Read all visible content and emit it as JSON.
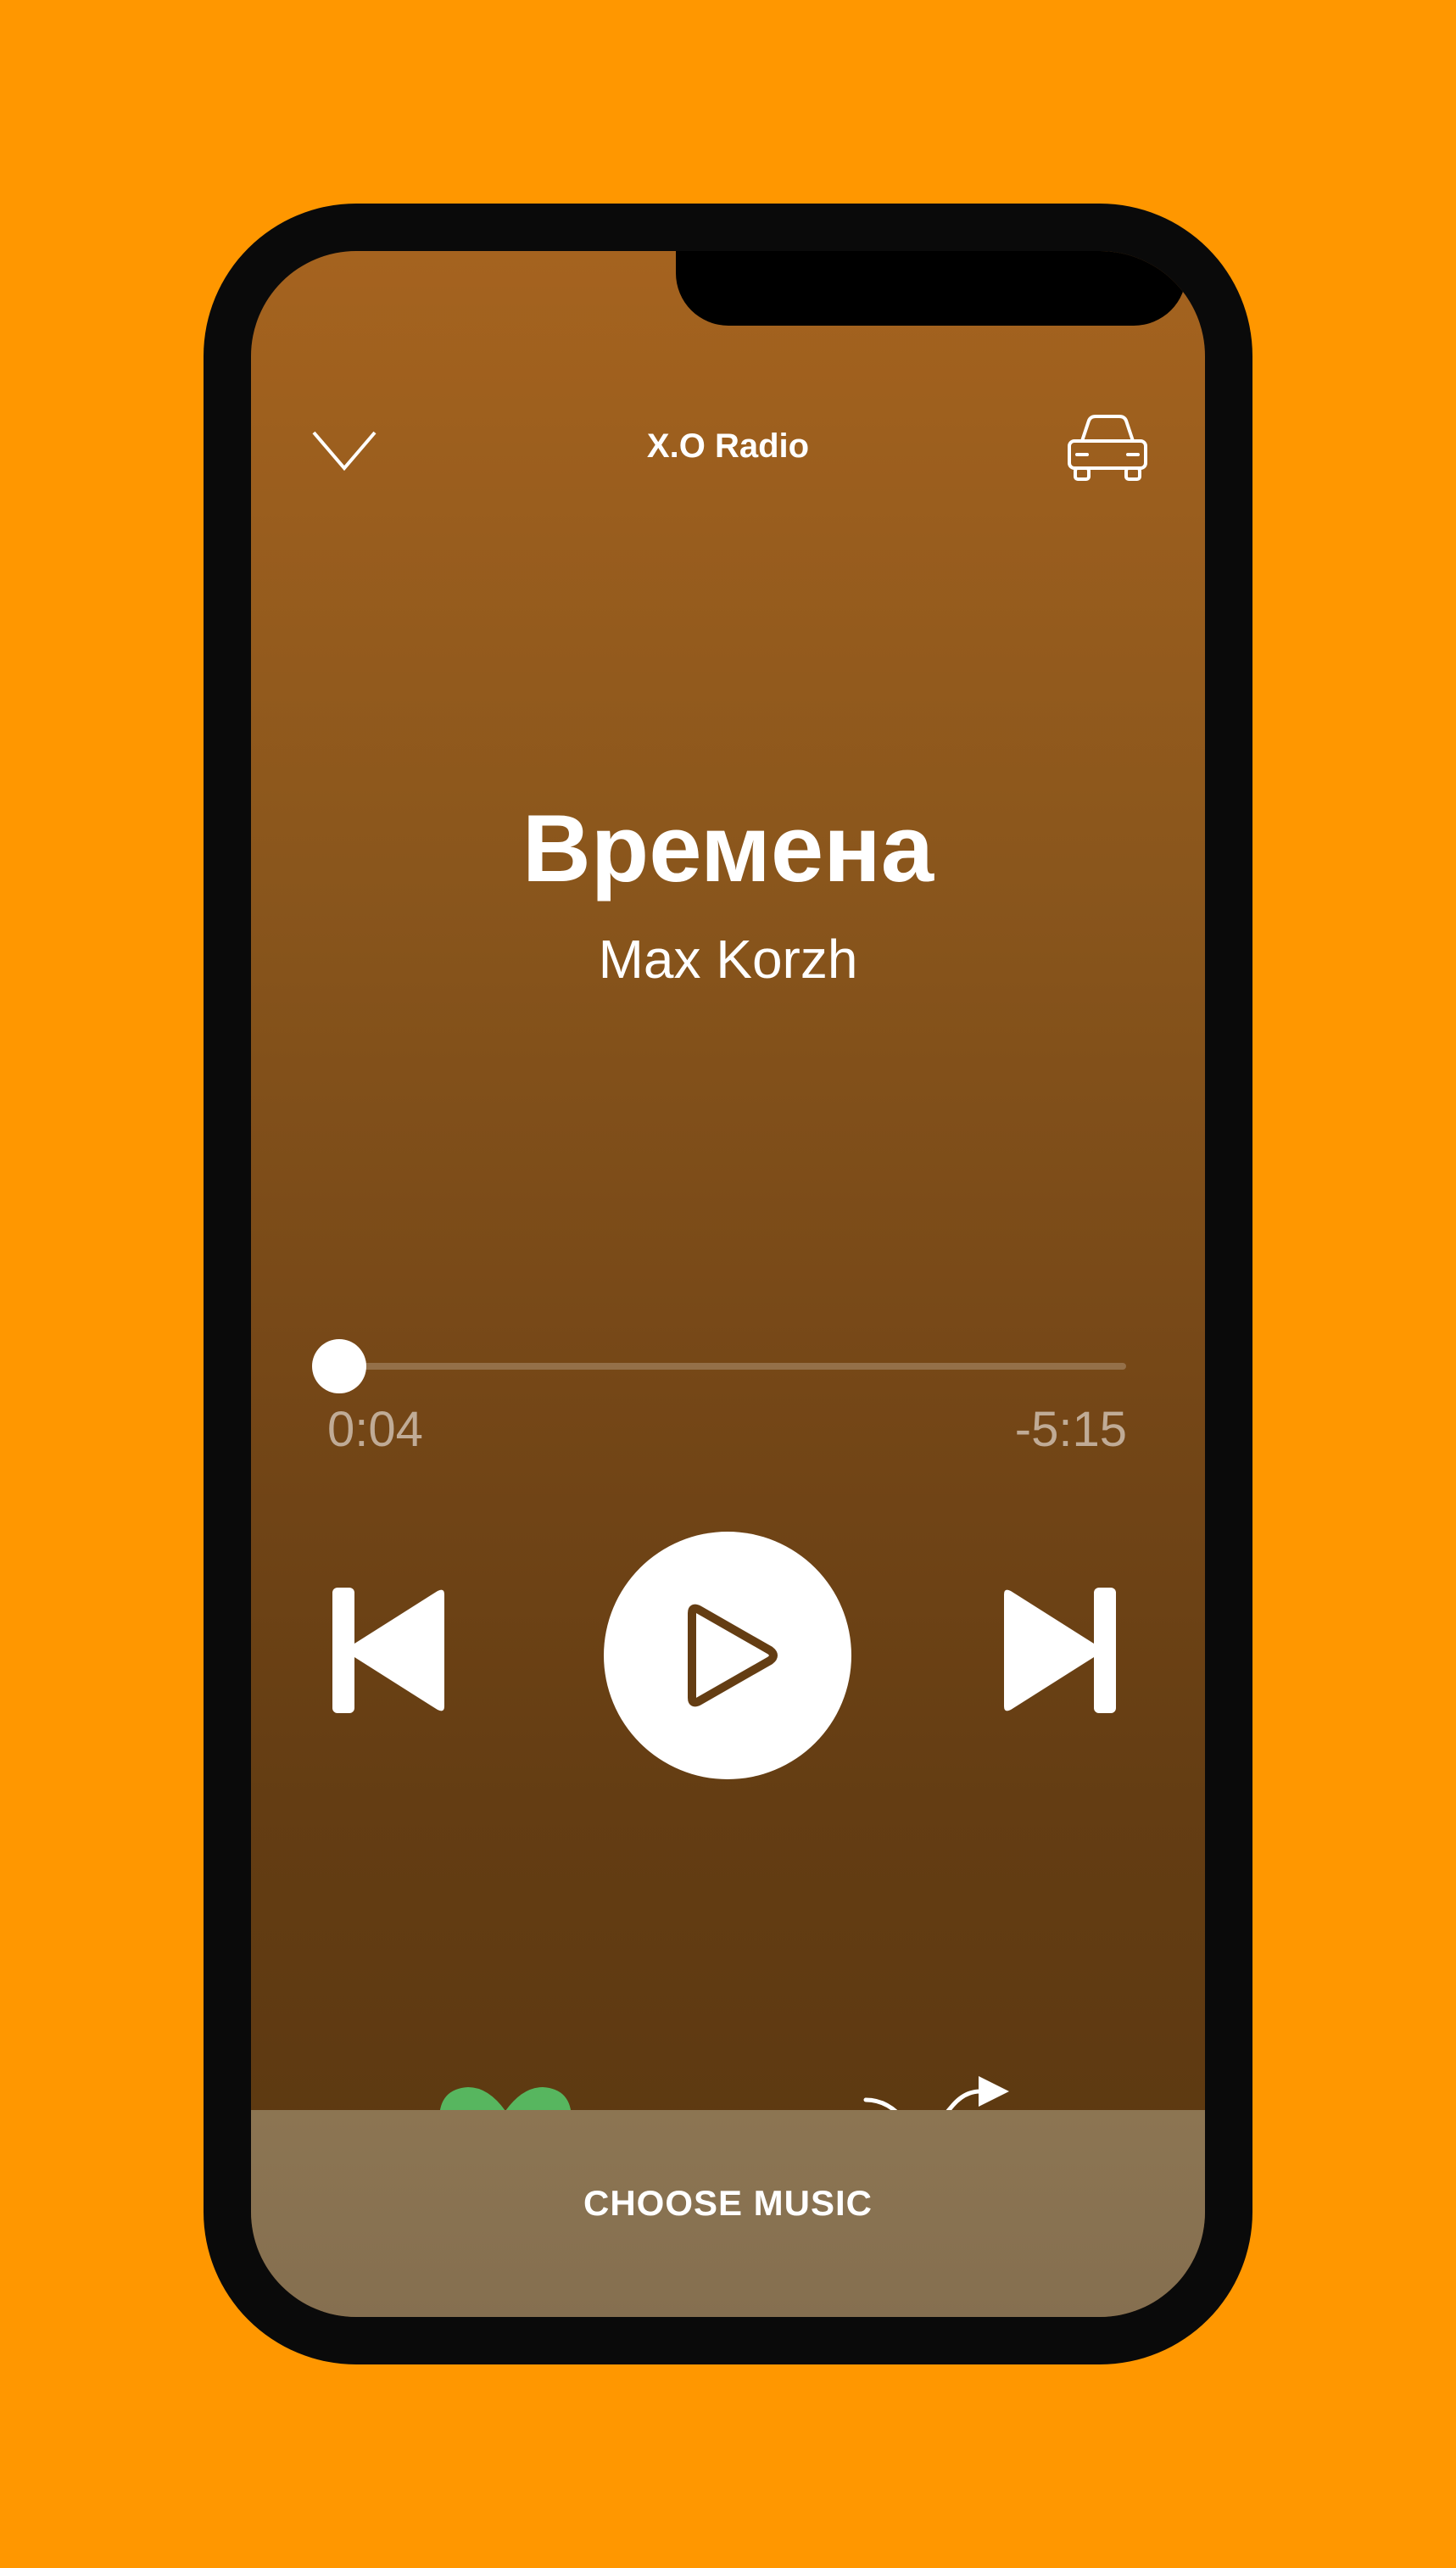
{
  "header": {
    "station": "X.O Radio",
    "collapse_icon": "chevron-down-icon",
    "car_icon": "car-icon"
  },
  "track": {
    "title": "Времена",
    "artist": "Max Korzh"
  },
  "progress": {
    "elapsed": "0:04",
    "remaining": "-5:15",
    "fraction": 0.0125
  },
  "controls": {
    "previous_icon": "skip-previous-icon",
    "play_icon": "play-icon",
    "next_icon": "skip-next-icon",
    "like_icon": "heart-icon",
    "shuffle_icon": "shuffle-icon"
  },
  "colors": {
    "background": "#FF9700",
    "like_active": "#57B65F"
  },
  "footer": {
    "choose_label": "CHOOSE MUSIC"
  }
}
